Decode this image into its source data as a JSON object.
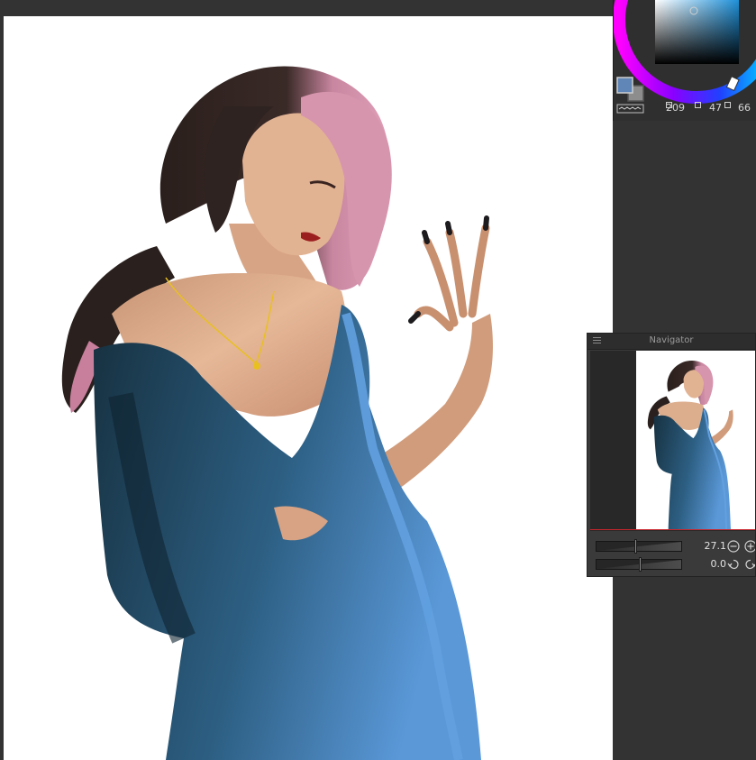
{
  "color_panel": {
    "hue_value": "209",
    "saturation_value": "47",
    "value_value": "66",
    "current_color": "#5f86b6",
    "secondary_color": "#8d8d8d",
    "hue_icon": "hue-square-icon",
    "saturation_icon": "saturation-square-icon",
    "value_icon": "value-square-icon"
  },
  "navigator": {
    "title": "Navigator",
    "zoom_value": "27.1",
    "rotation_value": "0.0",
    "zoom_level": 0.45,
    "rotation_level": 0.5,
    "icons": {
      "menu": "menu-icon",
      "zoom_out": "zoom-out-icon",
      "zoom_in": "zoom-in-icon",
      "rotate_left": "rotate-left-icon",
      "rotate_right": "rotate-right-icon"
    }
  },
  "canvas": {
    "background": "#ffffff",
    "palette": {
      "hair_dark": "#2b211e",
      "hair_pink": "#d795ad",
      "skin": "#e2b393",
      "skin_shadow": "#c98f72",
      "dress_dark": "#16303f",
      "dress_mid": "#2d5f83",
      "dress_light": "#62a0e0",
      "necklace": "#e8c020",
      "lips": "#9c1f1f",
      "nails": "#1d1b1e"
    }
  }
}
